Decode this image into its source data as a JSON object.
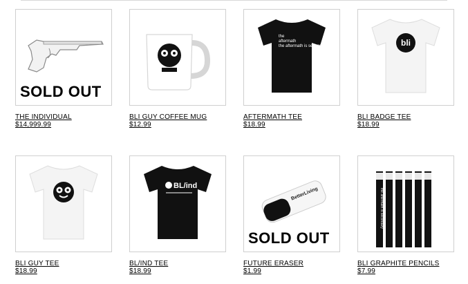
{
  "products": [
    {
      "name": "THE INDIVIDUAL",
      "price": "$14,999.99",
      "sold_out": "SOLD OUT",
      "image": "gun-image"
    },
    {
      "name": "BLI GUY COFFEE MUG",
      "price": "$12.99",
      "sold_out": "",
      "image": "mug-image"
    },
    {
      "name": "AFTERMATH TEE",
      "price": "$18.99",
      "sold_out": "",
      "image": "aftermath-tee-image"
    },
    {
      "name": "BLI BADGE TEE",
      "price": "$18.99",
      "sold_out": "",
      "image": "badge-tee-image"
    },
    {
      "name": "BLI GUY TEE",
      "price": "$18.99",
      "sold_out": "",
      "image": "guy-tee-image"
    },
    {
      "name": "BL/IND TEE",
      "price": "$18.99",
      "sold_out": "",
      "image": "blind-tee-image"
    },
    {
      "name": "FUTURE ERASER",
      "price": "$1.99",
      "sold_out": "SOLD OUT",
      "image": "eraser-image"
    },
    {
      "name": "BLI GRAPHITE PENCILS",
      "price": "$7.99",
      "sold_out": "",
      "image": "pencils-image"
    }
  ],
  "artwork": {
    "aftermath_print": "the aftermath is secondary.",
    "badge_logo": "bli",
    "blind_logo": "BL/ind",
    "eraser_brand": "BetterLiving",
    "pencil_print": "the aftermath is secondary"
  }
}
